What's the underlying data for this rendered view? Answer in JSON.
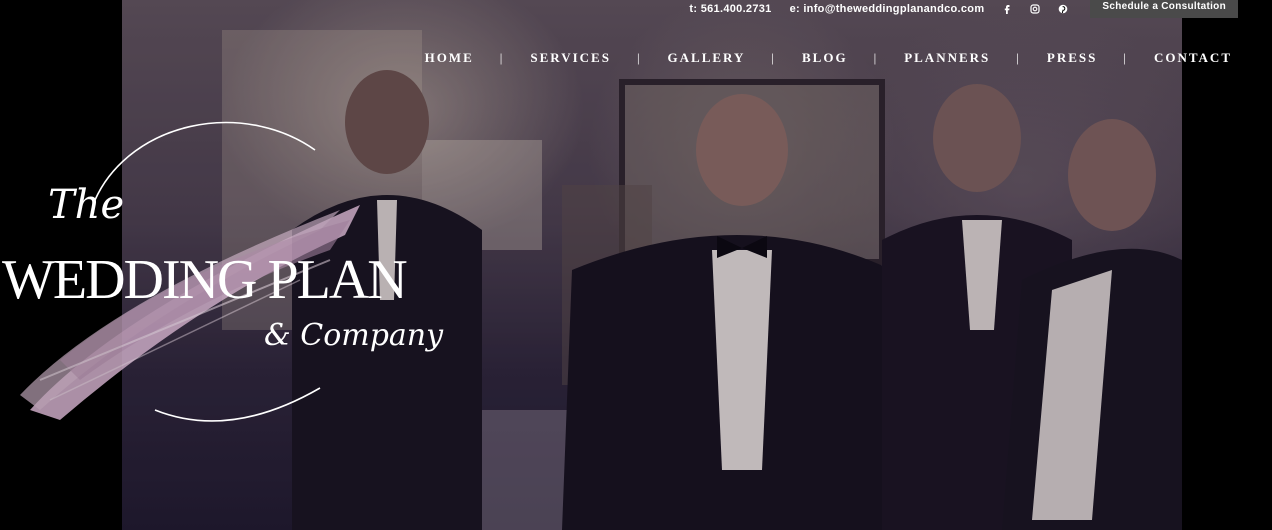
{
  "header": {
    "phone": "t: 561.400.2731",
    "email": "e: info@theweddingplanandco.com",
    "social_icons": [
      "facebook-icon",
      "instagram-icon",
      "pinterest-icon"
    ],
    "cta_label": "Schedule a Consultation"
  },
  "nav": {
    "items": [
      "HOME",
      "SERVICES",
      "GALLERY",
      "BLOG",
      "PLANNERS",
      "PRESS",
      "CONTACT"
    ],
    "separator": "|"
  },
  "logo": {
    "the": "The",
    "main": "WEDDING PLAN",
    "company": "& Company",
    "brush_color": "#c9a9c3"
  },
  "hero": {
    "background_color": "#000000",
    "video_tint": "#3a3040"
  }
}
